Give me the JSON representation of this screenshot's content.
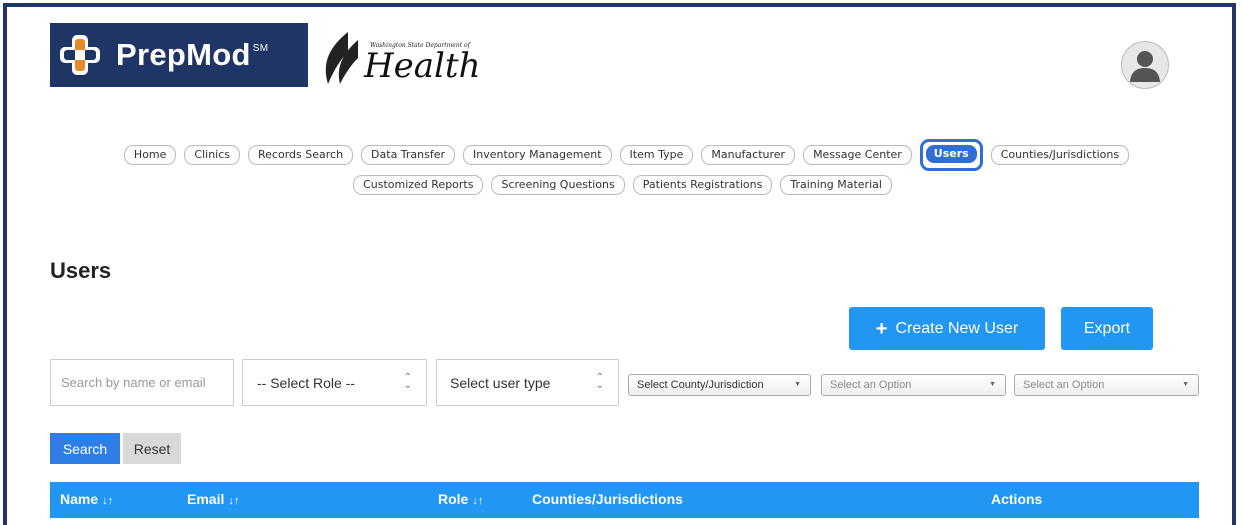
{
  "brand": {
    "app_name": "PrepMod",
    "app_mark": "SM",
    "partner_small": "Washington State Department of",
    "partner_name": "Health"
  },
  "nav": {
    "row1": [
      "Home",
      "Clinics",
      "Records Search",
      "Data Transfer",
      "Inventory Management",
      "Item Type",
      "Manufacturer",
      "Message Center",
      "Users",
      "Counties/Jurisdictions"
    ],
    "row2": [
      "Customized Reports",
      "Screening Questions",
      "Patients Registrations",
      "Training Material"
    ],
    "active": "Users"
  },
  "page": {
    "title": "Users",
    "create_button": "Create New User",
    "export_button": "Export"
  },
  "filters": {
    "search_placeholder": "Search by name or email",
    "role_select": "-- Select Role --",
    "user_type_select": "Select user type",
    "county_select": "Select County/Jurisdiction",
    "option_select_1": "Select an Option",
    "option_select_2": "Select an Option",
    "search_button": "Search",
    "reset_button": "Reset"
  },
  "table": {
    "columns": [
      "Name",
      "Email",
      "Role",
      "Counties/Jurisdictions",
      "Actions"
    ]
  },
  "colors": {
    "brand_navy": "#1f3566",
    "primary_blue": "#2196f3",
    "active_pill": "#2f6ed2"
  }
}
